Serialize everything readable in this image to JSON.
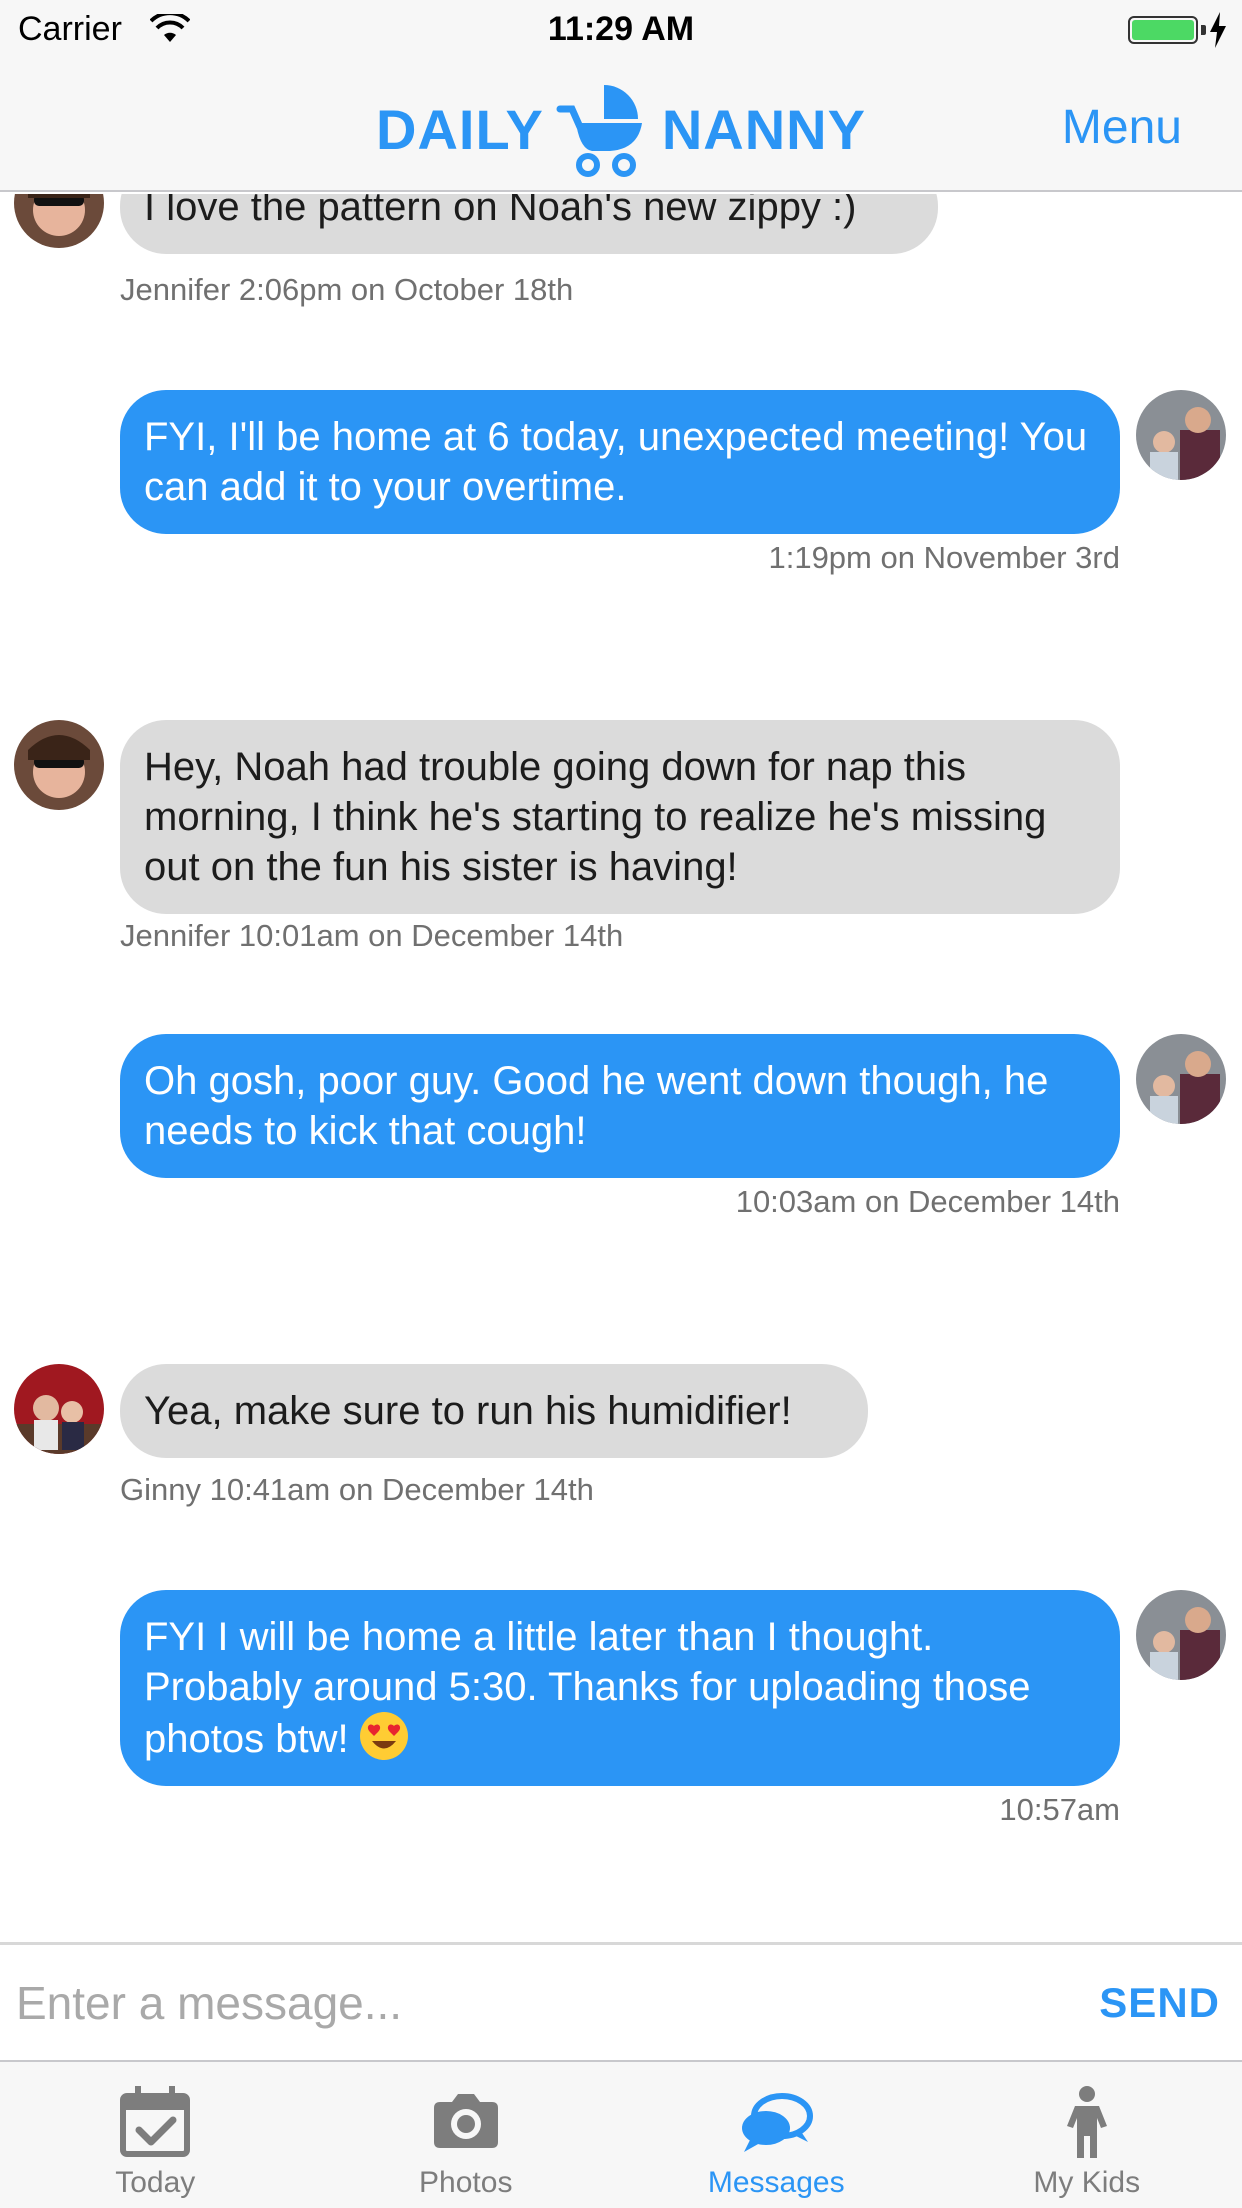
{
  "status_bar": {
    "carrier": "Carrier",
    "time": "11:29 AM"
  },
  "header": {
    "brand_left": "DAILY",
    "brand_right": "NANNY",
    "menu_label": "Menu"
  },
  "messages": [
    {
      "direction": "incoming",
      "text": "I love the pattern on Noah's new zippy :)",
      "meta": "Jennifer 2:06pm on October 18th"
    },
    {
      "direction": "outgoing",
      "text": "FYI, I'll be home at 6 today, unexpected meeting! You can add it to your overtime.",
      "meta": "1:19pm on November 3rd"
    },
    {
      "direction": "incoming",
      "text": "Hey, Noah had trouble going down for nap this morning, I think he's starting to realize he's missing out on the fun his sister is having!",
      "meta": "Jennifer 10:01am on December 14th"
    },
    {
      "direction": "outgoing",
      "text": "Oh gosh, poor guy. Good he went down though, he needs to kick that cough!",
      "meta": "10:03am on December 14th"
    },
    {
      "direction": "incoming",
      "text": "Yea, make sure to run his humidifier!",
      "meta": "Ginny 10:41am on December 14th"
    },
    {
      "direction": "outgoing",
      "text": "FYI I will be home a little later than I thought. Probably around 5:30. Thanks for uploading those photos btw!",
      "emoji": "heart-eyes-emoji",
      "meta": "10:57am"
    }
  ],
  "composer": {
    "placeholder": "Enter a message...",
    "value": "",
    "send_label": "SEND"
  },
  "tabs": [
    {
      "label": "Today",
      "icon": "calendar-check-icon",
      "active": false
    },
    {
      "label": "Photos",
      "icon": "camera-icon",
      "active": false
    },
    {
      "label": "Messages",
      "icon": "chat-bubbles-icon",
      "active": true
    },
    {
      "label": "My Kids",
      "icon": "child-icon",
      "active": false
    }
  ],
  "colors": {
    "accent": "#2b95f5",
    "incoming_bubble": "#dbdbdb",
    "outgoing_bubble": "#2b95f5",
    "battery": "#4cd964"
  }
}
